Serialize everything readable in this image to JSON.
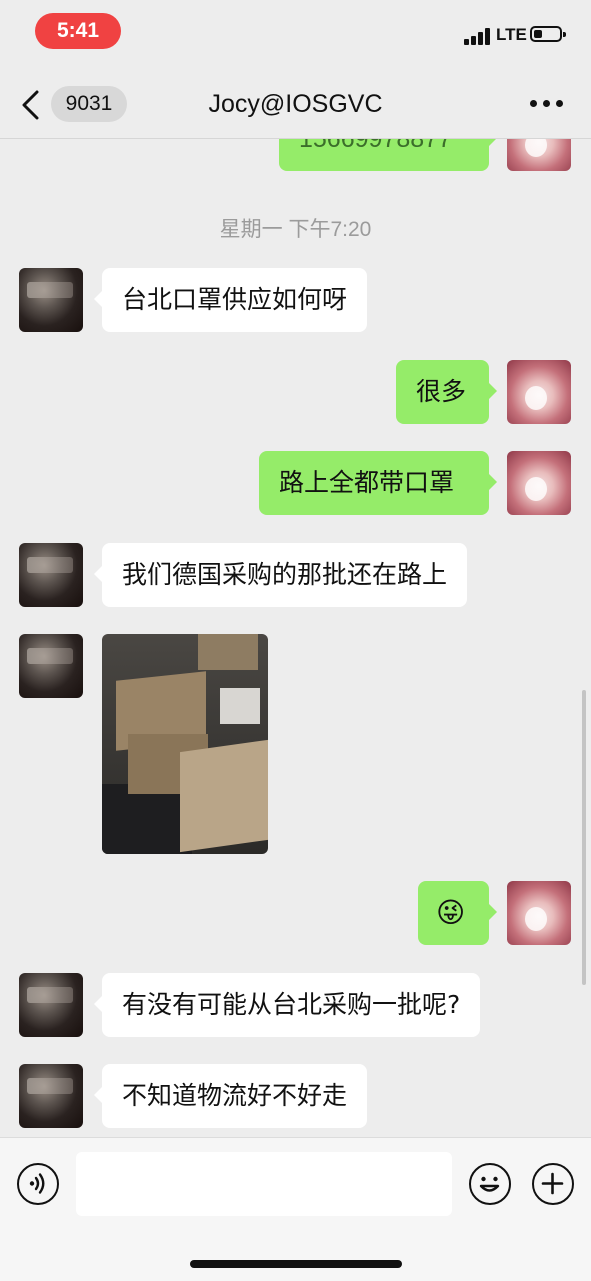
{
  "status_bar": {
    "time": "5:41",
    "network": "LTE"
  },
  "nav": {
    "back_icon": "chevron-left-icon",
    "unread_count": "9031",
    "title": "Jocy@IOSGVC",
    "more_icon": "ellipsis-icon"
  },
  "chat": {
    "partial_top_message": "15669978877",
    "timestamp": "星期一 下午7:20",
    "messages": [
      {
        "side": "them",
        "type": "text",
        "text": "台北口罩供应如何呀"
      },
      {
        "side": "me",
        "type": "text",
        "text": "很多"
      },
      {
        "side": "me",
        "type": "text",
        "text": "路上全都带口罩"
      },
      {
        "side": "them",
        "type": "text",
        "text": "我们德国采购的那批还在路上"
      },
      {
        "side": "them",
        "type": "image",
        "text": ""
      },
      {
        "side": "me",
        "type": "emoji",
        "text": "😜"
      },
      {
        "side": "them",
        "type": "text",
        "text": "有没有可能从台北采购一批呢?"
      },
      {
        "side": "them",
        "type": "text",
        "text": "不知道物流好不好走"
      }
    ]
  },
  "input_bar": {
    "voice_icon": "voice-icon",
    "text_value": "",
    "emoji_icon": "emoji-icon",
    "plus_icon": "plus-icon"
  },
  "colors": {
    "time_pill": "#f04242",
    "my_bubble": "#95ec69",
    "their_bubble": "#ffffff",
    "background": "#ededed"
  }
}
